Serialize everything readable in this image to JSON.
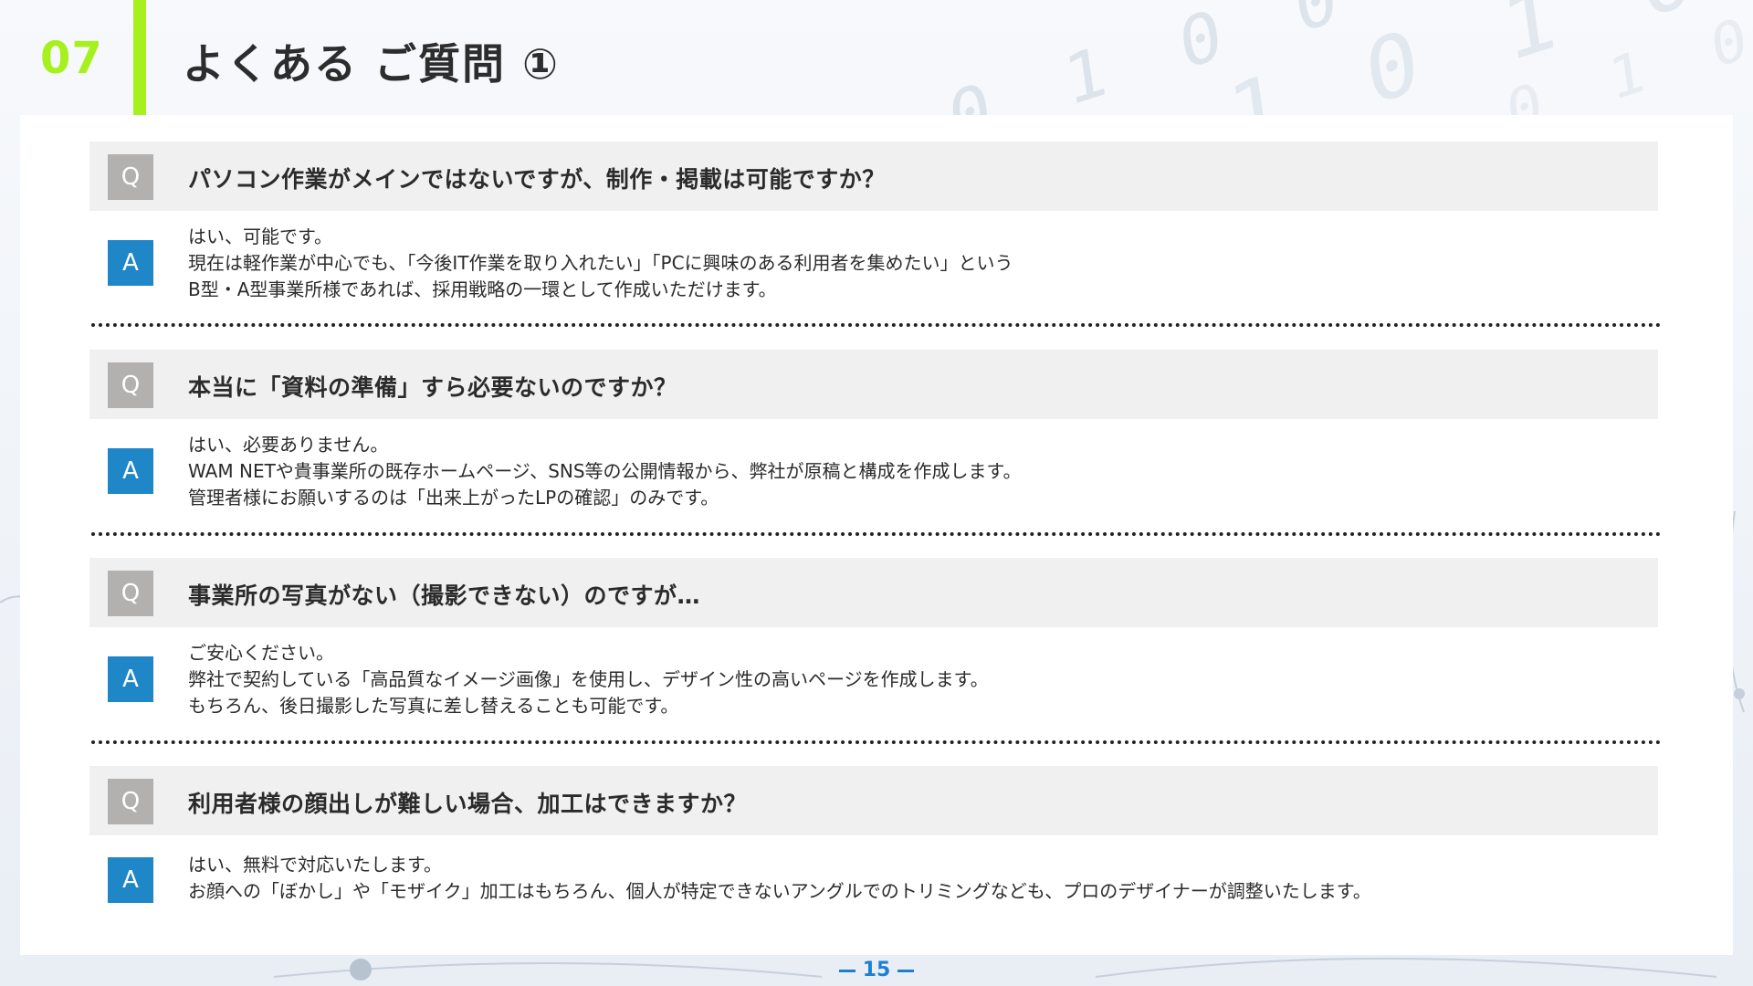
{
  "header": {
    "section_number": "07",
    "title": "よくある ご質問 ①"
  },
  "qa_items": [
    {
      "q_badge": "Q",
      "question": "パソコン作業がメインではないですが、制作・掲載は可能ですか？",
      "a_badge": "A",
      "answer_lines": [
        "はい、可能です。",
        "現在は軽作業が中心でも、「今後IT作業を取り入れたい」「PCに興味のある利用者を集めたい」という",
        "B型・A型事業所様であれば、採用戦略の一環として作成いただけます。"
      ]
    },
    {
      "q_badge": "Q",
      "question": "本当に「資料の準備」すら必要ないのですか？",
      "a_badge": "A",
      "answer_lines": [
        "はい、必要ありません。",
        "WAM NETや貴事業所の既存ホームページ、SNS等の公開情報から、弊社が原稿と構成を作成します。",
        "管理者様にお願いするのは「出来上がったLPの確認」のみです。"
      ]
    },
    {
      "q_badge": "Q",
      "question": "事業所の写真がない（撮影できない）のですが…",
      "a_badge": "A",
      "answer_lines": [
        "ご安心ください。",
        "弊社で契約している「高品質なイメージ画像」を使用し、デザイン性の高いページを作成します。",
        "もちろん、後日撮影した写真に差し替えることも可能です。"
      ]
    },
    {
      "q_badge": "Q",
      "question": "利用者様の顔出しが難しい場合、加工はできますか？",
      "a_badge": "A",
      "answer_lines": [
        "はい、無料で対応いたします。",
        "お顔への「ぼかし」や「モザイク」加工はもちろん、個人が特定できないアングルでのトリミングなども、プロのデザイナーが調整いたします。"
      ]
    }
  ],
  "footer": {
    "page_number": "15"
  },
  "colors": {
    "accent_green": "#a6f11d",
    "answer_blue": "#1f86c8",
    "question_gray": "#b3b0b0",
    "page_number_blue": "#1e7fd0"
  }
}
